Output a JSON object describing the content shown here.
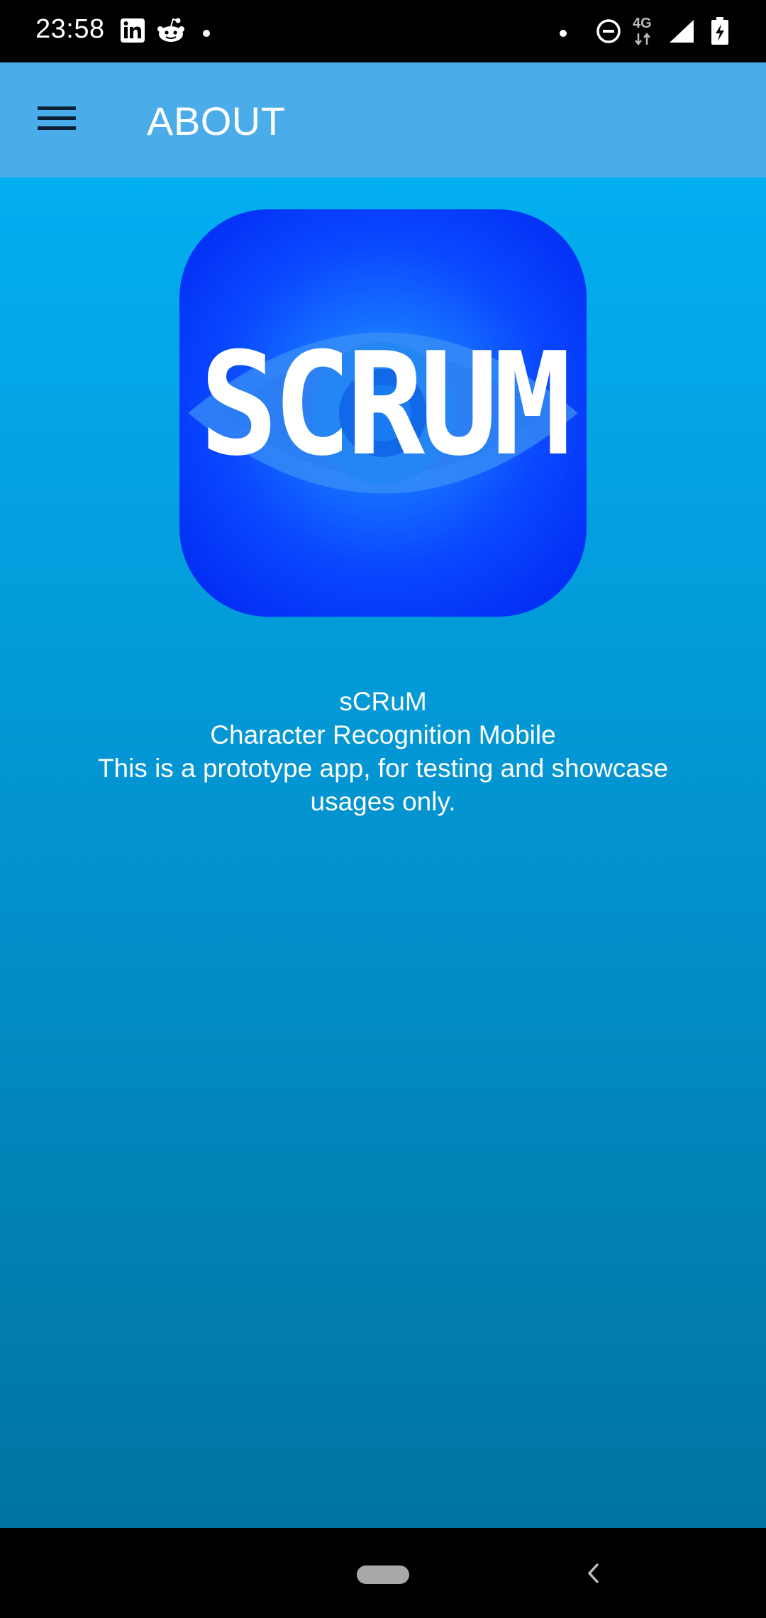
{
  "status_bar": {
    "time": "23:58",
    "network_label": "4G",
    "icons": [
      "linkedin-icon",
      "reddit-icon",
      "notification-dot-icon",
      "dot-icon",
      "do-not-disturb-icon",
      "mobile-data-icon",
      "signal-icon",
      "battery-charging-icon"
    ]
  },
  "app_bar": {
    "title": "ABOUT",
    "menu_icon": "hamburger-menu-icon",
    "background": "#4aace8"
  },
  "logo": {
    "text": "SCRUM",
    "icon": "eye-icon"
  },
  "about": {
    "app_name": "sCRuM",
    "subtitle": "Character Recognition Mobile",
    "description": "This is a prototype app, for testing and showcase usages only."
  },
  "nav_bar": {
    "icons": [
      "home-pill-icon",
      "back-chevron-icon"
    ]
  },
  "colors": {
    "content_top": "#03aef0",
    "content_bottom": "#0073a0",
    "logo_blue": "#0a48ff",
    "text": "#ffffff"
  }
}
